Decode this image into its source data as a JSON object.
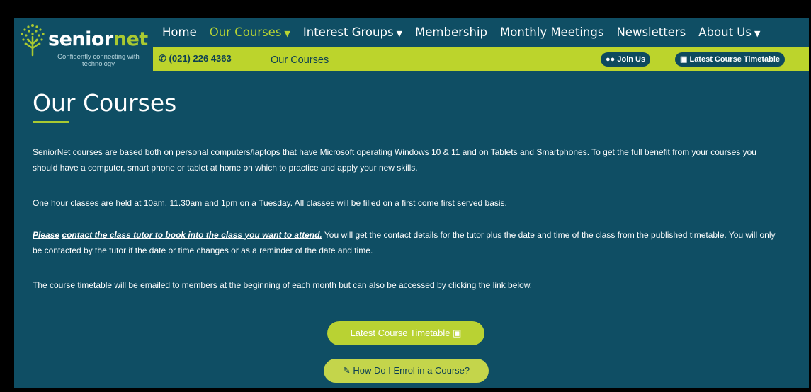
{
  "logo": {
    "brand_part1": "senior",
    "brand_part2": "net",
    "tagline": "Confidently connecting with technology"
  },
  "nav": {
    "items": [
      {
        "label": "Home",
        "active": false,
        "dropdown": false
      },
      {
        "label": "Our Courses",
        "active": true,
        "dropdown": true
      },
      {
        "label": "Interest Groups",
        "active": false,
        "dropdown": true
      },
      {
        "label": "Membership",
        "active": false,
        "dropdown": false
      },
      {
        "label": "Monthly Meetings",
        "active": false,
        "dropdown": false
      },
      {
        "label": "Newsletters",
        "active": false,
        "dropdown": false
      },
      {
        "label": "About Us",
        "active": false,
        "dropdown": true
      }
    ]
  },
  "subbar": {
    "phone": "(021) 226 4363",
    "breadcrumb": "Our Courses",
    "join_label": "Join Us",
    "latest_label": "Latest Course Timetable"
  },
  "main": {
    "title": "Our Courses",
    "p1": "SeniorNet courses are based both on personal computers/laptops that have Microsoft operating Windows 10 & 11 and on Tablets and Smartphones.  To get the full benefit from your courses you should have a computer, smart phone or tablet at home on which to practice and apply your new skills.",
    "p2": "One hour classes are held at 10am, 11.30am and 1pm on a Tuesday.  All classes will be filled on a first come first served basis.",
    "p3_link1": "Please",
    "p3_link2": "contact the class tutor to book into the class you want to attend.",
    "p3_rest": "  You will get the contact details for the tutor plus the date and time of the class from the published timetable. You will only be contacted by the tutor if the date or time changes or as a reminder of the date and time.",
    "p4": "The course timetable will be emailed to members at the beginning of each month but can also be accessed by clicking the link below.",
    "btn_latest": "Latest Course Timetable",
    "btn_enrol": "How Do I Enrol in a Course?"
  },
  "colors": {
    "background": "#0f4e64",
    "accent": "#bcd42c",
    "text": "#ffffff"
  }
}
